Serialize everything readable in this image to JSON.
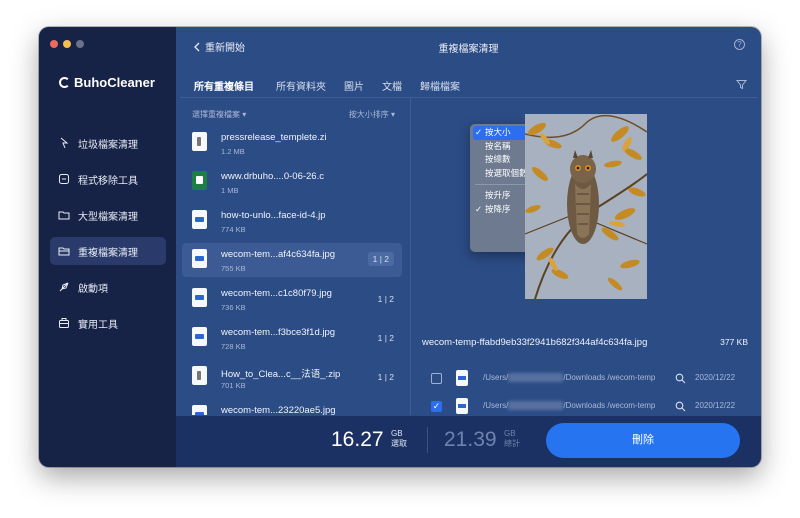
{
  "app": {
    "brand": "BuhoCleaner"
  },
  "sidebar": {
    "items": [
      {
        "label": "垃圾檔案清理",
        "icon": "trash-icon"
      },
      {
        "label": "程式移除工具",
        "icon": "app-icon"
      },
      {
        "label": "大型檔案清理",
        "icon": "folder-icon"
      },
      {
        "label": "重複檔案清理",
        "icon": "duplicate-folder-icon",
        "active": true
      },
      {
        "label": "啟動項",
        "icon": "rocket-icon"
      },
      {
        "label": "實用工具",
        "icon": "toolbox-icon"
      }
    ]
  },
  "header": {
    "back_label": "重新開始",
    "title": "重複檔案清理"
  },
  "tabs": [
    {
      "label": "所有重複條目",
      "active": true
    },
    {
      "label": "所有資料夾"
    },
    {
      "label": "圖片"
    },
    {
      "label": "文檔"
    },
    {
      "label": "歸檔檔案"
    }
  ],
  "list": {
    "select_label": "選擇重複檔案",
    "sort_label": "按大小排序",
    "files": [
      {
        "name": "pressrelease_templete.zi",
        "size": "1.2 MB",
        "count": "",
        "type": "doc"
      },
      {
        "name": "www.drbuho....0-06-26.c",
        "size": "1 MB",
        "count": "",
        "type": "xls"
      },
      {
        "name": "how-to-unlo...face-id-4.jp",
        "size": "774 KB",
        "count": "",
        "type": "img"
      },
      {
        "name": "wecom-tem...af4c634fa.jpg",
        "size": "755 KB",
        "count": "1 | 2",
        "type": "img",
        "active": true
      },
      {
        "name": "wecom-tem...c1c80f79.jpg",
        "size": "736 KB",
        "count": "1 | 2",
        "type": "img"
      },
      {
        "name": "wecom-tem...f3bce3f1d.jpg",
        "size": "728 KB",
        "count": "1 | 2",
        "type": "img"
      },
      {
        "name": "How_to_Clea...c__法语_.zip",
        "size": "701 KB",
        "count": "1 | 2",
        "type": "zip"
      },
      {
        "name": "wecom-tem...23220ae5.jpg",
        "size": "",
        "count": "",
        "type": "img"
      }
    ]
  },
  "sort_menu": {
    "items": [
      {
        "label": "按大小",
        "checked": true,
        "selected": true
      },
      {
        "label": "按名稱"
      },
      {
        "label": "按總數"
      },
      {
        "label": "按選取個數"
      }
    ],
    "order_items": [
      {
        "label": "按升序"
      },
      {
        "label": "按降序",
        "checked": true
      }
    ],
    "check_mark": "✓"
  },
  "preview": {
    "filename": "wecom-temp-ffabd9eb33f2941b682f344af4c634fa.jpg",
    "size": "377 KB",
    "paths": [
      {
        "prefix": "/Users/",
        "suffix": "/Downloads /wecom-temp",
        "date": "2020/12/22",
        "checked": false
      },
      {
        "prefix": "/Users/",
        "suffix": "/Downloads /wecom-temp",
        "date": "2020/12/22",
        "checked": true
      }
    ]
  },
  "footer": {
    "selected_value": "16.27",
    "selected_unit": "GB",
    "selected_label": "選取",
    "total_value": "21.39",
    "total_unit": "GB",
    "total_label": "總計",
    "delete_label": "刪除"
  },
  "colors": {
    "sidebar": "#172247",
    "main": "#2c4c86",
    "accent": "#2774f0",
    "bottom_bar": "#1b3163"
  }
}
